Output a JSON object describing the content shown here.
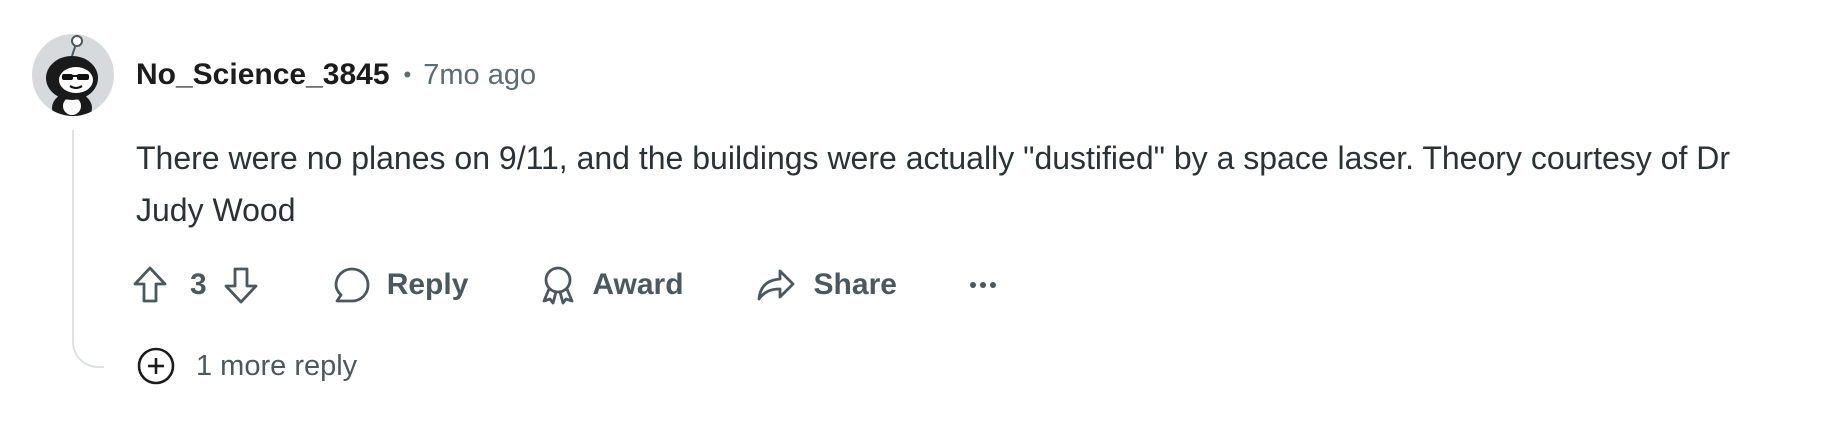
{
  "comment": {
    "username": "No_Science_3845",
    "separator": "•",
    "timestamp": "7mo ago",
    "body": "There were no planes on 9/11, and the buildings were actually \"dustified\" by a space laser. Theory courtesy of Dr Judy Wood",
    "avatar_icon": "snoo-avatar-icon"
  },
  "actions": {
    "upvote_icon": "upvote-arrow-icon",
    "vote_count": "3",
    "downvote_icon": "downvote-arrow-icon",
    "reply_label": "Reply",
    "award_label": "Award",
    "share_label": "Share",
    "more_icon": "ellipsis-icon"
  },
  "more_replies": {
    "label": "1 more reply",
    "icon": "plus-circle-icon"
  },
  "colors": {
    "text_primary": "#1c1c1c",
    "text_secondary": "#5c6c74",
    "action_text": "#4b585f",
    "thread_line": "#dfe2e4"
  }
}
